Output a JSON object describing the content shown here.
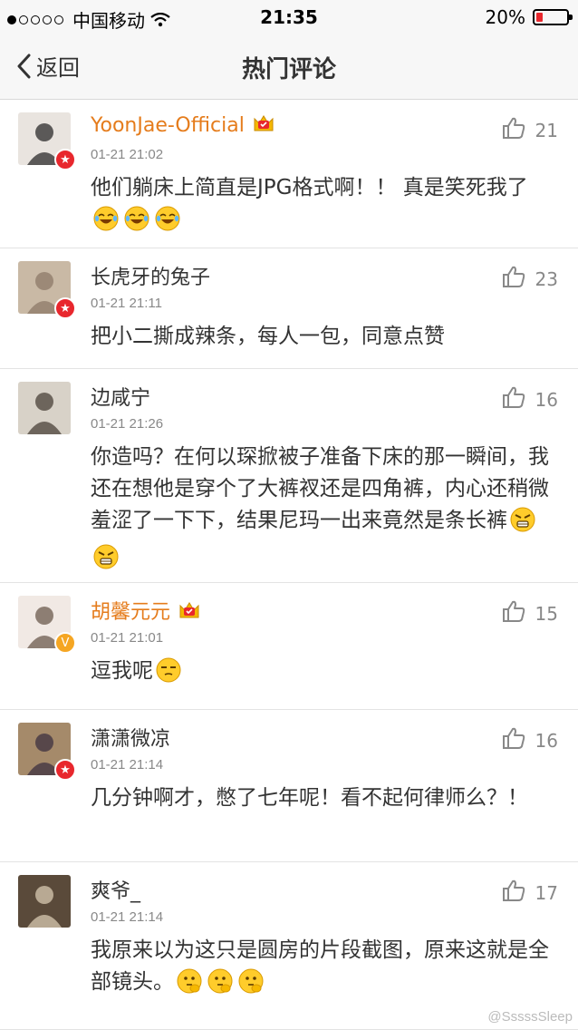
{
  "status_bar": {
    "carrier": "中国移动",
    "time": "21:35",
    "battery": "20%",
    "battery_level": 0.2
  },
  "nav": {
    "back_label": "返回",
    "title": "热门评论"
  },
  "comments": [
    {
      "name": "YoonJae-Official",
      "time": "01-21 21:02",
      "likes": "21",
      "text": "他们躺床上简直是JPG格式啊！！ 真是笑死我了",
      "emojis": [
        "laughing-cry",
        "laughing-cry",
        "laughing-cry"
      ],
      "badge": "verified-red",
      "vip": true
    },
    {
      "name": "长虎牙的兔子",
      "time": "01-21 21:11",
      "likes": "23",
      "text": "把小二撕成辣条，每人一包，同意点赞",
      "emojis": [],
      "badge": "verified-red",
      "vip": false
    },
    {
      "name": "边咸宁",
      "time": "01-21 21:26",
      "likes": "16",
      "text": "你造吗？在何以琛掀被子准备下床的那一瞬间，我还在想他是穿个了大裤衩还是四角裤，内心还稍微羞涩了一下下，结果尼玛一出来竟然是条长裤",
      "emojis": [
        "angry",
        "angry"
      ],
      "badge": "none",
      "vip": false
    },
    {
      "name": "胡馨元元",
      "time": "01-21 21:01",
      "likes": "15",
      "text": "逗我呢",
      "emojis": [
        "unamused"
      ],
      "badge": "verified-yellow",
      "vip": true
    },
    {
      "name": "潇潇微凉",
      "time": "01-21 21:14",
      "likes": "16",
      "text": "几分钟啊才，憋了七年呢！看不起何律师么？！",
      "emojis": [],
      "badge": "verified-red",
      "vip": false
    },
    {
      "name": "爽爷_",
      "time": "01-21 21:14",
      "likes": "17",
      "text": "我原来以为这只是圆房的片段截图，原来这就是全部镜头。",
      "emojis": [
        "thinking",
        "thinking",
        "thinking"
      ],
      "badge": "none",
      "vip": false
    }
  ],
  "watermark": "@SssssSleep",
  "colors": {
    "vip_name": "#e57c1c",
    "badge_red": "#e8272d",
    "badge_yellow": "#f5a623",
    "battery_low": "#e8272d"
  }
}
